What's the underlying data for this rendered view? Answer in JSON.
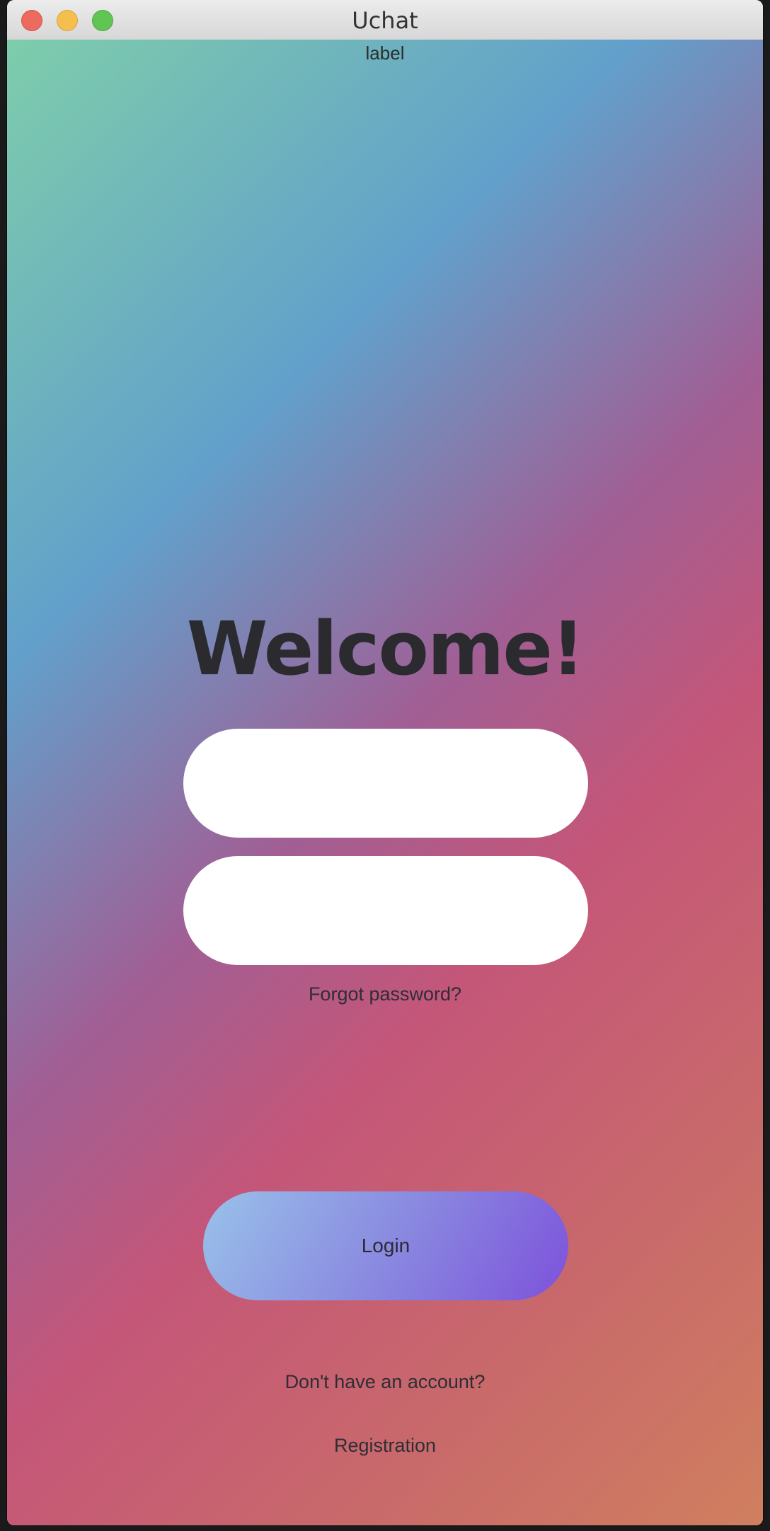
{
  "window": {
    "title": "Uchat"
  },
  "header": {
    "label": "label"
  },
  "main": {
    "heading": "Welcome!",
    "username_value": "",
    "password_value": "",
    "forgot_password": "Forgot password?",
    "login_label": "Login",
    "no_account_text": "Don't have an account?",
    "registration_label": "Registration"
  },
  "colors": {
    "gradient_start": "#7ecdab",
    "gradient_mid": "#62a0cb",
    "gradient_end": "#d07f5f",
    "login_button_start": "#99c1ea",
    "login_button_end": "#7d52db"
  }
}
